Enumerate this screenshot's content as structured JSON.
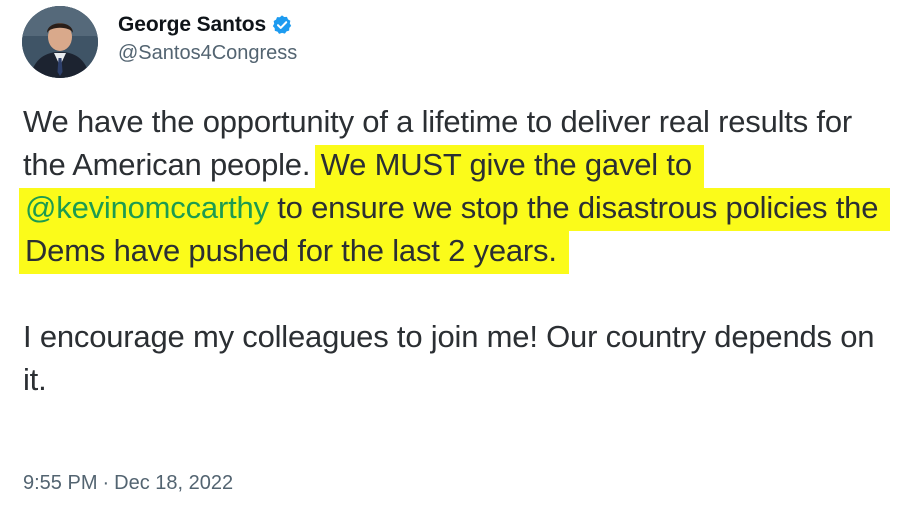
{
  "author": {
    "name": "George Santos",
    "handle": "@Santos4Congress",
    "verified": true,
    "avatar_icon": "avatar-photo-icon",
    "verified_icon": "verified-badge-icon",
    "verified_color": "#1d9bf0"
  },
  "tweet": {
    "paragraph1": {
      "plain": "We have the opportunity of a lifetime to deliver real results for the American people. ",
      "highlighted_before_mention": "We MUST give the gavel to ",
      "mention": "@kevinomccarthy",
      "highlighted_after_mention": " to ensure we stop the disastrous policies the Dems have pushed for the last 2 years."
    },
    "paragraph2": "I encourage my colleagues to join me! Our country depends on it.",
    "time": "9:55 PM",
    "separator": "·",
    "date": "Dec 18, 2022"
  },
  "colors": {
    "highlight": "#fbfb1a",
    "mention": "#1d9b50",
    "secondary_text": "#536471"
  }
}
